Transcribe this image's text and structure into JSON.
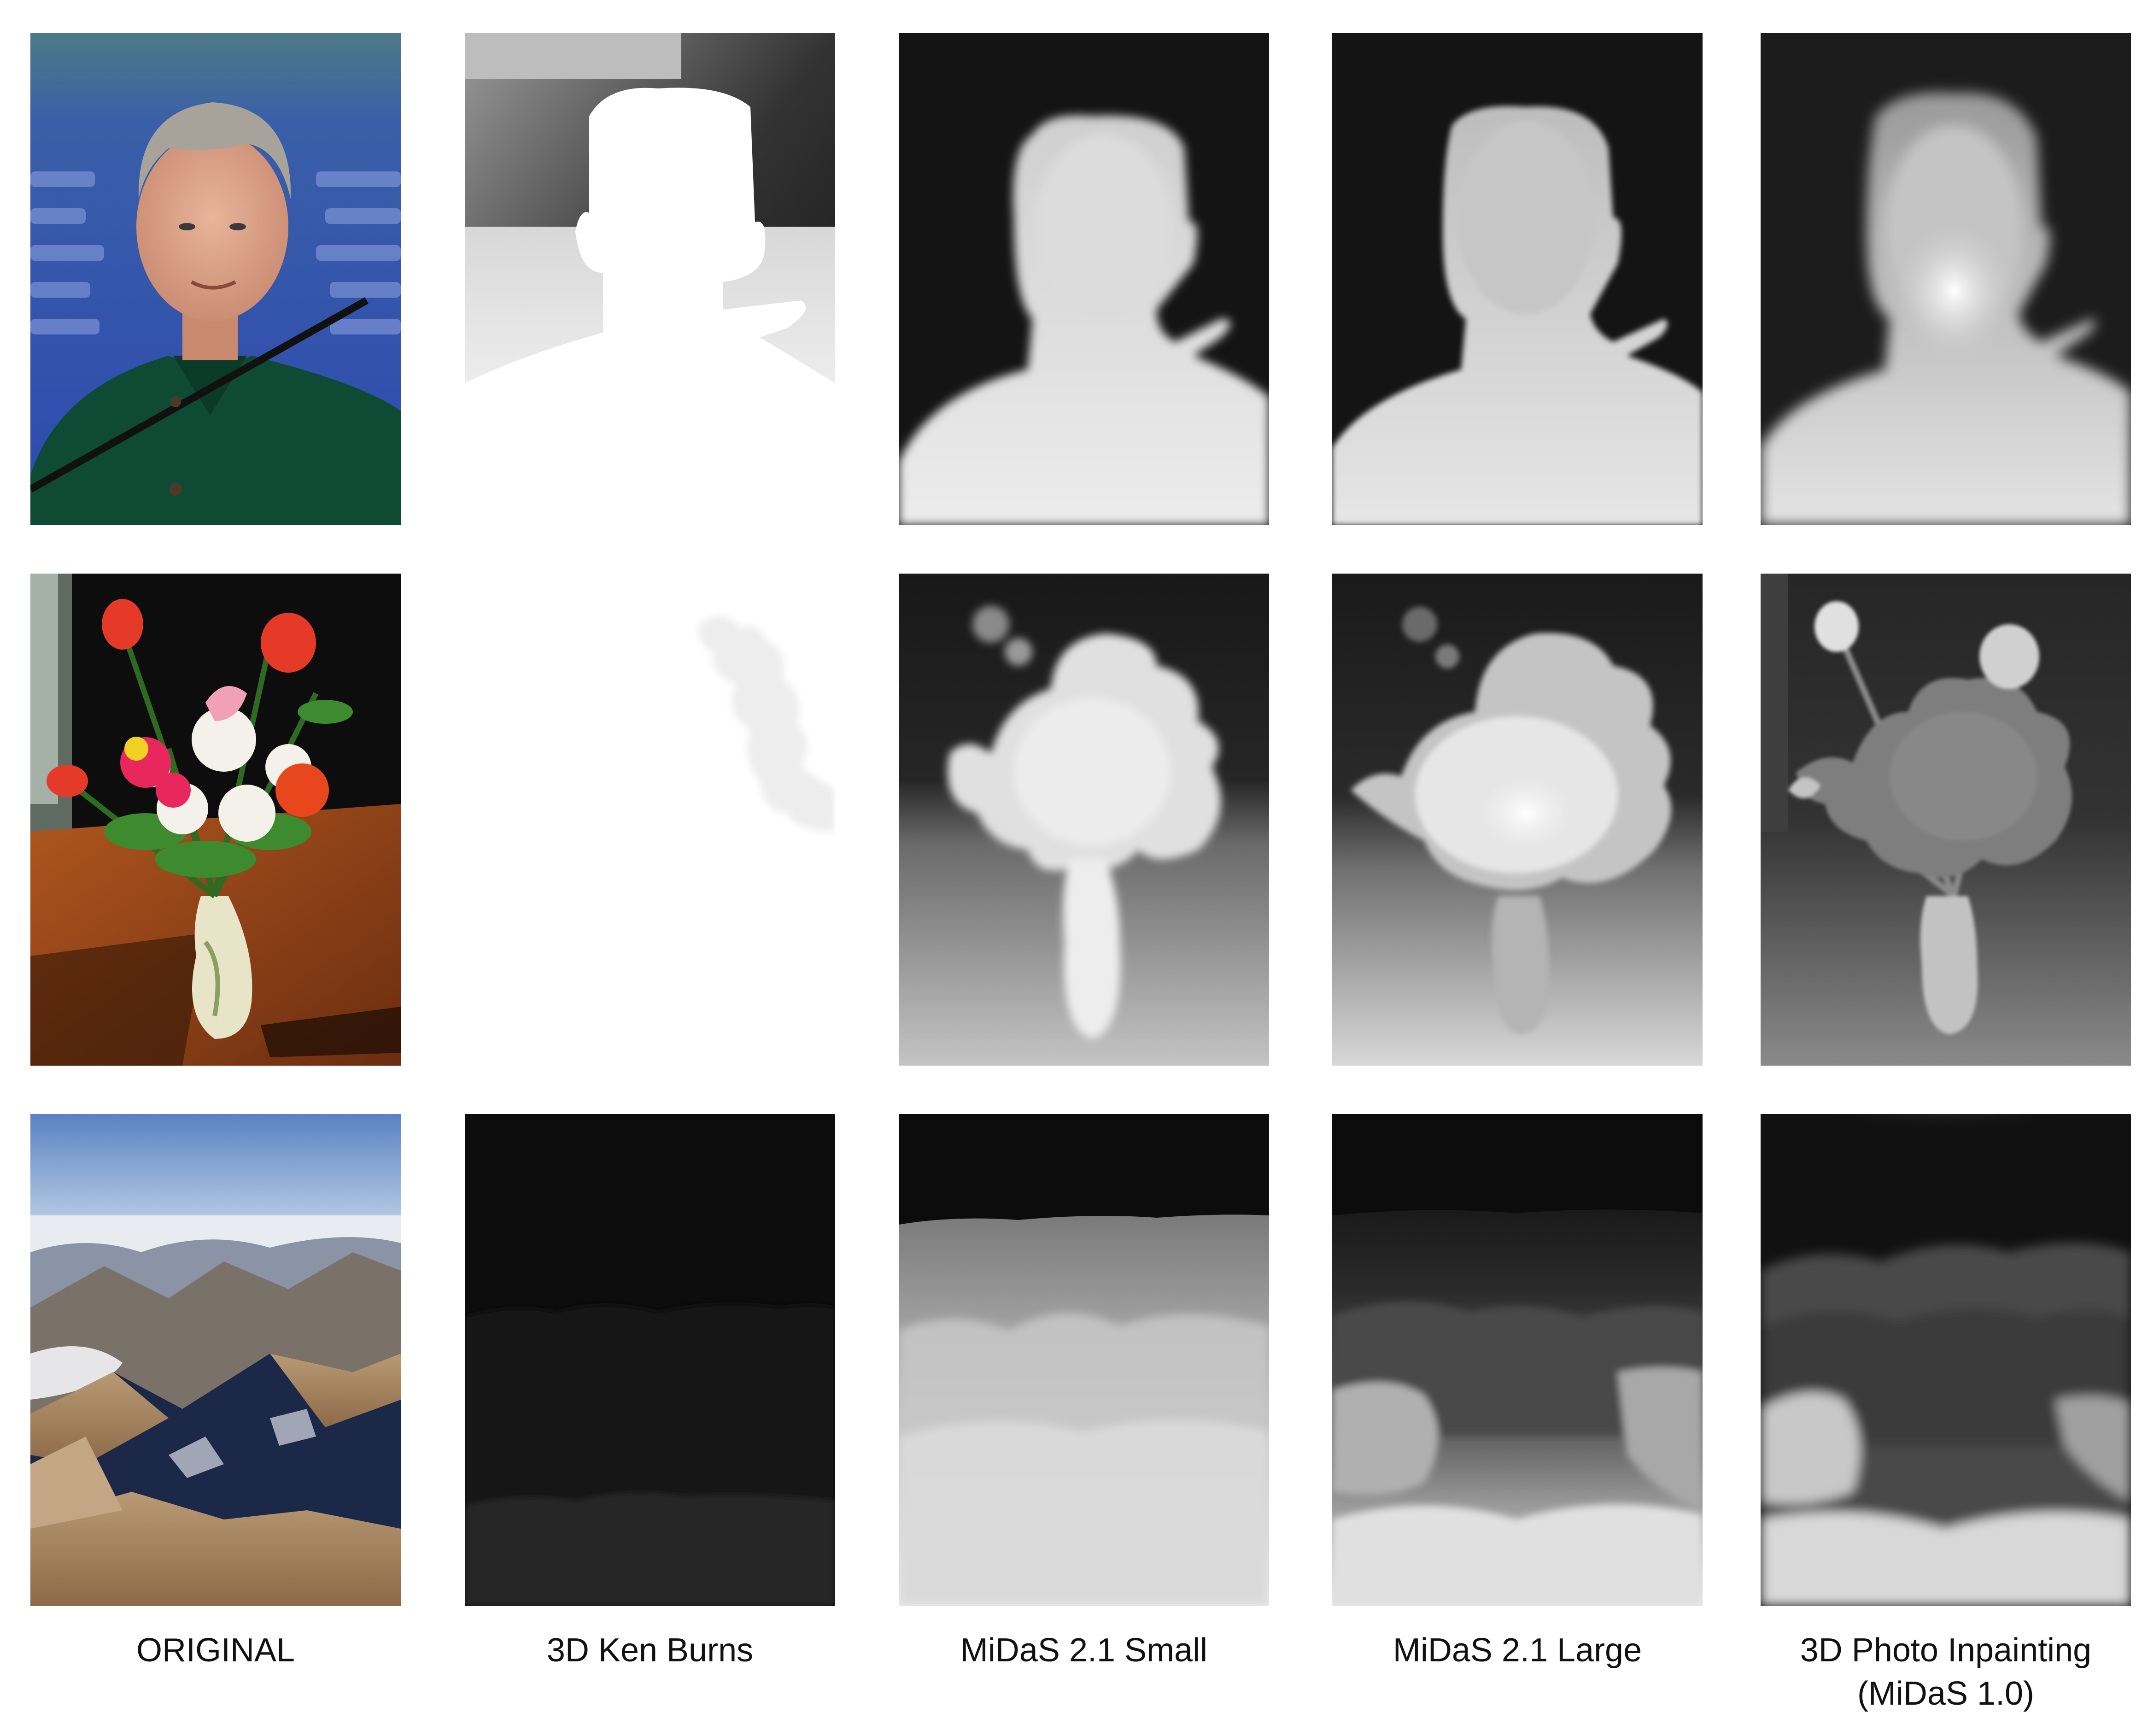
{
  "columns": [
    {
      "label": "ORIGINAL"
    },
    {
      "label": "3D Ken Burns"
    },
    {
      "label": "MiDaS 2.1 Small"
    },
    {
      "label": "MiDaS 2.1 Large"
    },
    {
      "label": "3D Photo Inpainting",
      "label_line2": "(MiDaS 1.0)"
    }
  ],
  "rows": [
    {
      "subject": "portrait"
    },
    {
      "subject": "flowers"
    },
    {
      "subject": "mountains"
    }
  ],
  "colors": {
    "background": "#ffffff",
    "text": "#111111",
    "depth_far": "#111111",
    "depth_near": "#f2f2f2"
  }
}
